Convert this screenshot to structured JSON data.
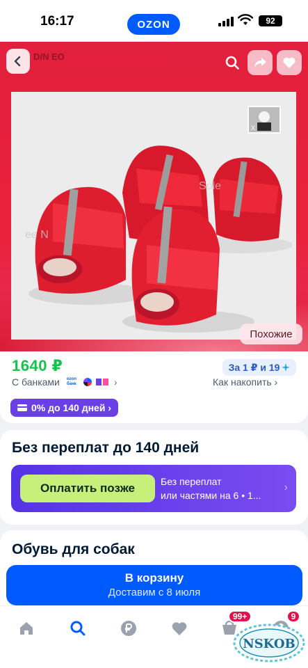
{
  "status_bar": {
    "time": "16:17",
    "app_label": "OZON",
    "battery": "92"
  },
  "hero": {
    "brand_overlay": "D/N EO",
    "similar_label": "Похожие",
    "thumb_text": "Х"
  },
  "price": {
    "value": "1640 ₽",
    "banks_label": "С банками",
    "bank_ozon": "ozon банк",
    "points": "За 1 ₽ и 19",
    "how_save": "Как накопить ›",
    "installment": "0% до 140 дней ›"
  },
  "bnpl": {
    "title": "Без переплат до 140 дней",
    "button": "Оплатить позже",
    "line1": "Без переплат",
    "line2": "или частями на 6 • 1..."
  },
  "category": {
    "title": "Обувь для собак"
  },
  "cart": {
    "label": "В корзину",
    "delivery": "Доставим с 8 июля"
  },
  "tabs": {
    "cart_badge": "99+",
    "profile_badge": "9"
  },
  "watermark": "NSKOB",
  "colors": {
    "brand_blue": "#005bff",
    "price_green": "#10c44c",
    "hero_red": "#e8203a",
    "bnpl_purple": "#6b3fe6"
  }
}
